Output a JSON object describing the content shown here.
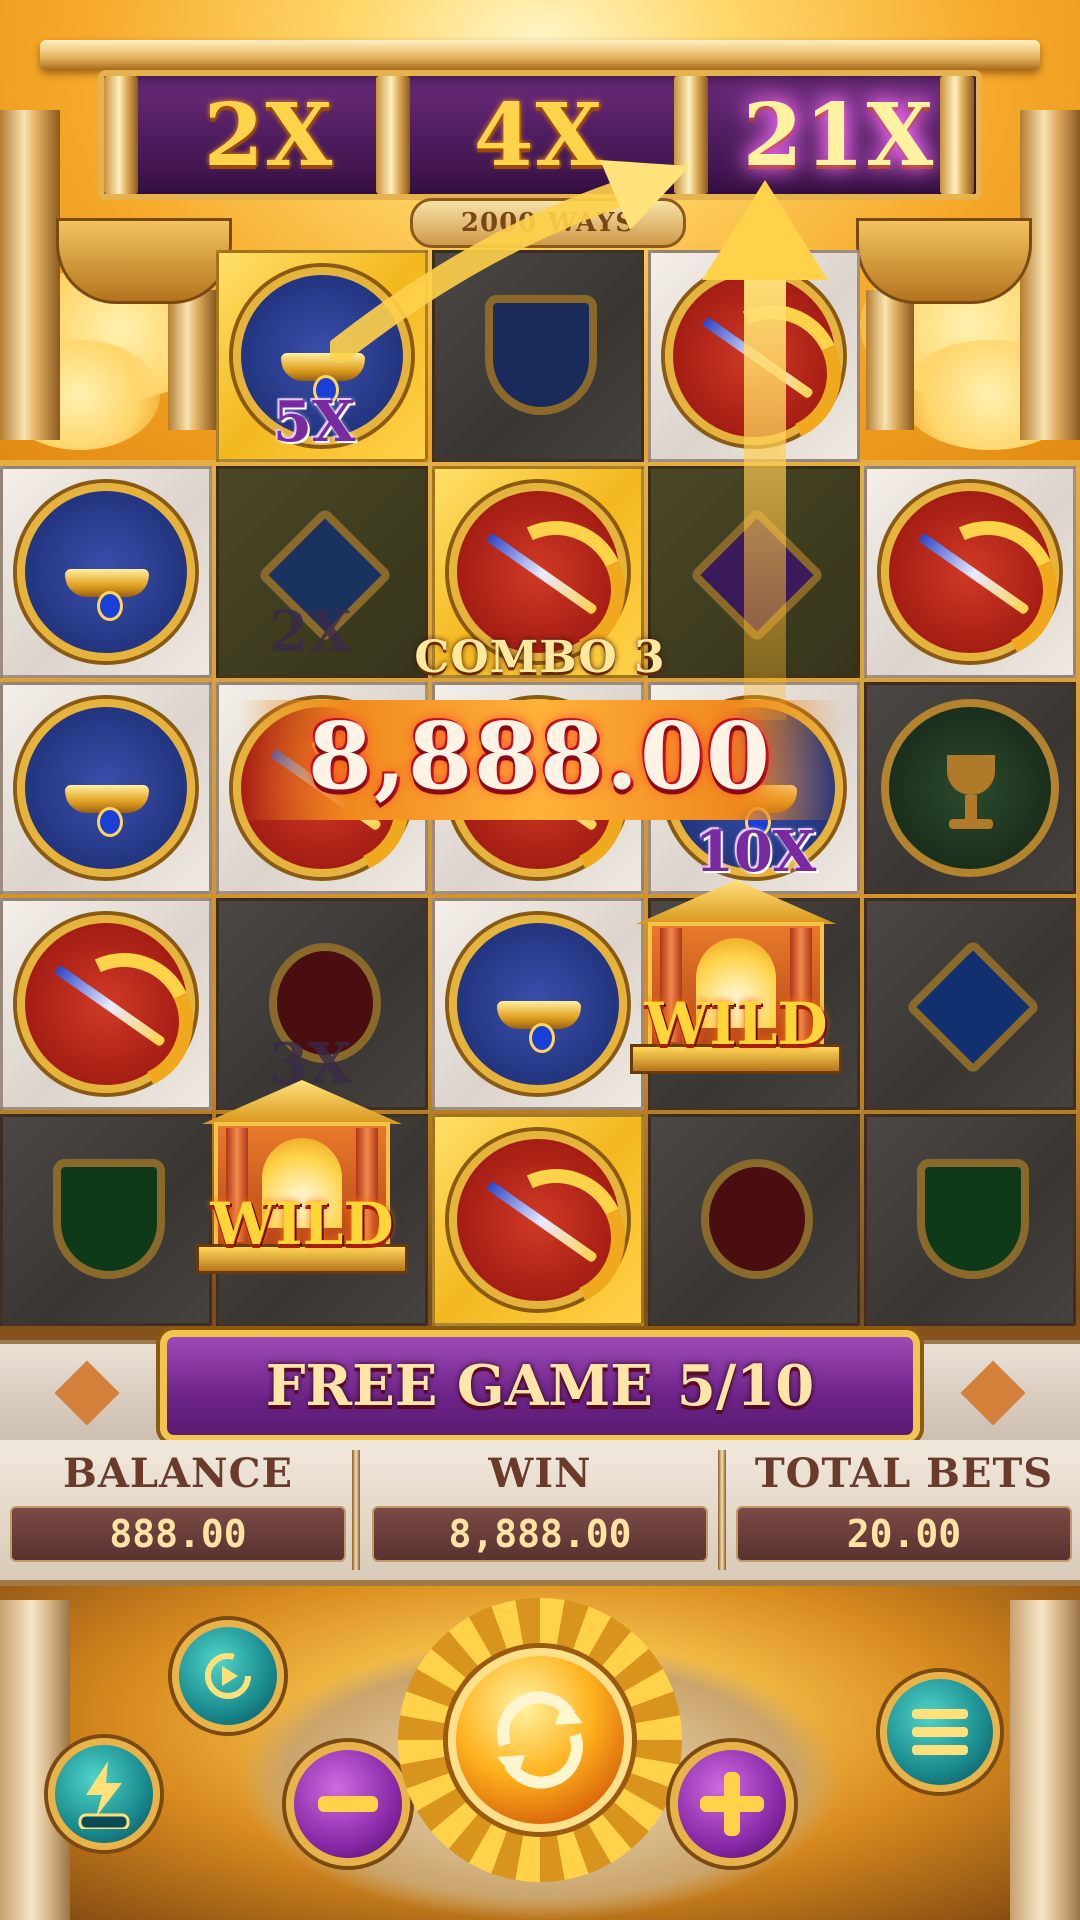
{
  "multipliers": [
    {
      "label": "2X",
      "active": false
    },
    {
      "label": "4X",
      "active": false
    },
    {
      "label": "21X",
      "active": true
    }
  ],
  "ways_label": "2000 WAYS",
  "grid_multipliers": {
    "r0c1": "5X",
    "r1c1": "2X",
    "r2c3": "10X",
    "r3c1": "3X"
  },
  "wild_label": "WILD",
  "combo_label": "COMBO  3",
  "win_amount": "8,888.00",
  "free_game": {
    "label": "FREE GAME",
    "count": "5/10"
  },
  "info": {
    "balance_label": "BALANCE",
    "balance_value": "888.00",
    "win_label": "WIN",
    "win_value": "8,888.00",
    "bets_label": "TOTAL BETS",
    "bets_value": "20.00"
  },
  "controls": {
    "autoplay_icon": "replay-icon",
    "turbo_icon": "lightning-icon",
    "minus_icon": "minus-icon",
    "spin_icon": "spin-icon",
    "plus_icon": "plus-icon",
    "menu_icon": "menu-icon"
  },
  "colors": {
    "gold": "#ffd34a",
    "purple": "#6d2c7c",
    "win_red": "#c0101e"
  }
}
